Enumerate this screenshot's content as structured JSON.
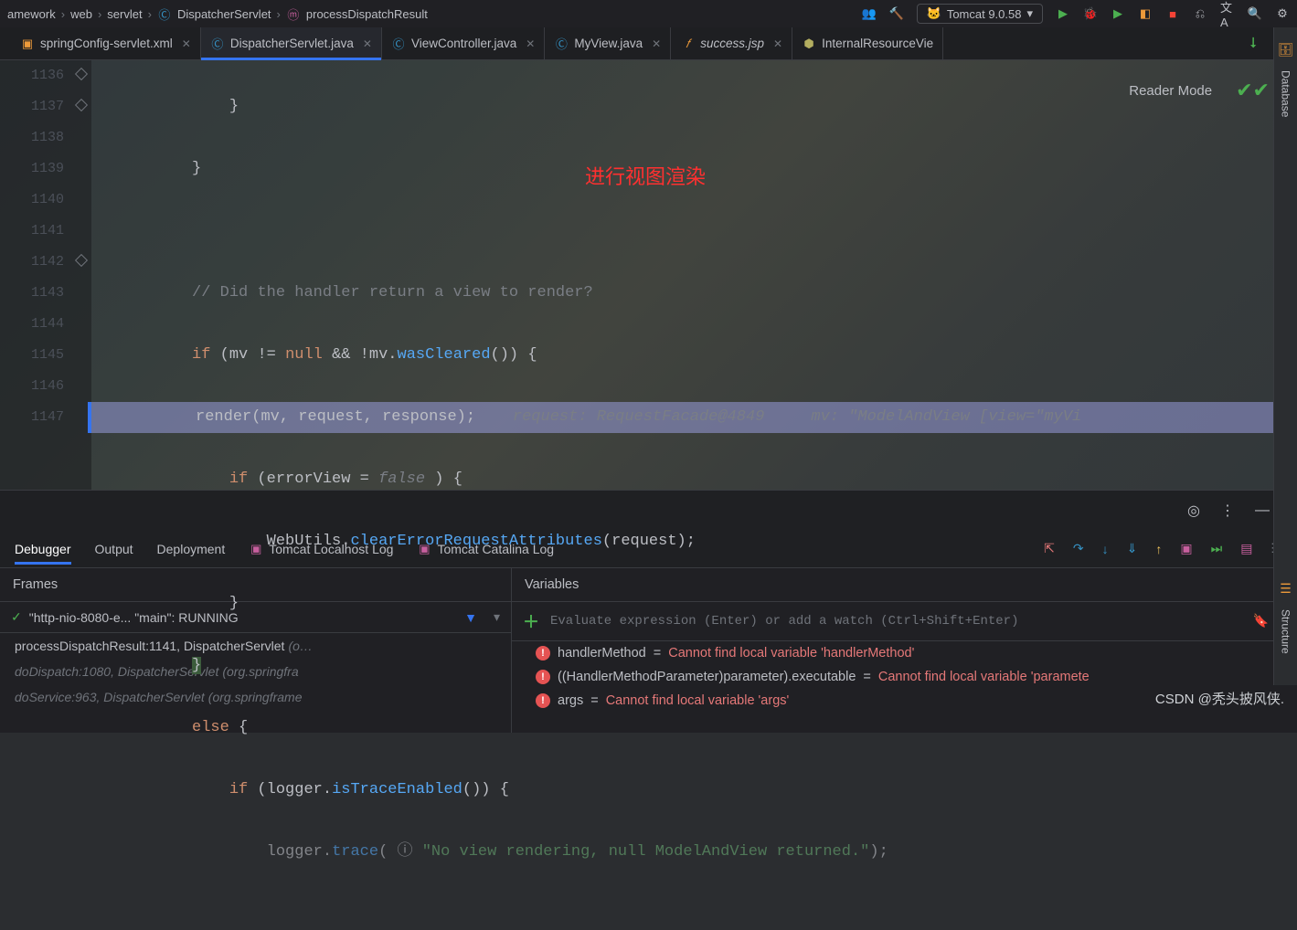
{
  "breadcrumbs": [
    "amework",
    "web",
    "servlet",
    "DispatcherServlet",
    "processDispatchResult"
  ],
  "runConfig": {
    "label": "Tomcat 9.0.58",
    "icon": "tomcat-icon"
  },
  "tabs": [
    {
      "label": "springConfig-servlet.xml",
      "icon": "xml",
      "active": false
    },
    {
      "label": "DispatcherServlet.java",
      "icon": "java",
      "active": true
    },
    {
      "label": "ViewController.java",
      "icon": "java",
      "active": false
    },
    {
      "label": "MyView.java",
      "icon": "java",
      "active": false
    },
    {
      "label": "success.jsp",
      "icon": "jsp",
      "active": false
    },
    {
      "label": "InternalResourceVie",
      "icon": "java-lib",
      "active": false
    }
  ],
  "readerMode": "Reader Mode",
  "editor": {
    "lines": [
      "1136",
      "1137",
      "1138",
      "1139",
      "1140",
      "1141",
      "1142",
      "1143",
      "1144",
      "1145",
      "1146",
      "1147"
    ],
    "comment": "// Did the handler return a view to render?",
    "annotation": "进行视图渲染",
    "code": {
      "if_kw": "if",
      "mv": "mv",
      "null": "null",
      "op1": "!= ",
      "op2": "&& !",
      "wasCleared": "wasCleared",
      "render": "render",
      "renderArgs": "(mv, request, response);",
      "inlayReq": "request: RequestFacade@4849",
      "inlayMv": "mv: \"ModelAndView [view=\"myVi",
      "errorView": "errorView",
      "false": " false ",
      "webutils": "WebUtils",
      "clearErr": "clearErrorRequestAttributes",
      "request": "request",
      "else": "else",
      "logger": "logger",
      "isTrace": "isTraceEnabled",
      "trace": "trace",
      "traceStr": "\"No view rendering, null ModelAndView returned.\""
    }
  },
  "debug": {
    "tabs": [
      "Debugger",
      "Output",
      "Deployment"
    ],
    "logTabs": [
      "Tomcat Localhost Log",
      "Tomcat Catalina Log"
    ],
    "frames": {
      "title": "Frames",
      "thread": "\"http-nio-8080-e... \"main\": RUNNING",
      "stack": [
        {
          "m": "processDispatchResult:1141, DispatcherServlet",
          "p": "(o…",
          "dim": false
        },
        {
          "m": "doDispatch:1080, DispatcherServlet",
          "p": "(org.springfra",
          "dim": true
        },
        {
          "m": "doService:963, DispatcherServlet",
          "p": "(org.springframe",
          "dim": true
        }
      ]
    },
    "vars": {
      "title": "Variables",
      "evalPlaceholder": "Evaluate expression (Enter) or add a watch (Ctrl+Shift+Enter)",
      "rows": [
        {
          "name": "handlerMethod",
          "op": "=",
          "err": "Cannot find local variable 'handlerMethod'"
        },
        {
          "name": "((HandlerMethodParameter)parameter).executable",
          "op": "=",
          "err": "Cannot find local variable 'paramete"
        },
        {
          "name": "args",
          "op": "=",
          "err": "Cannot find local variable 'args'"
        }
      ]
    }
  },
  "watermark": "CSDN @秃头披风侠.",
  "rightRail": [
    "Database",
    "Structure"
  ]
}
